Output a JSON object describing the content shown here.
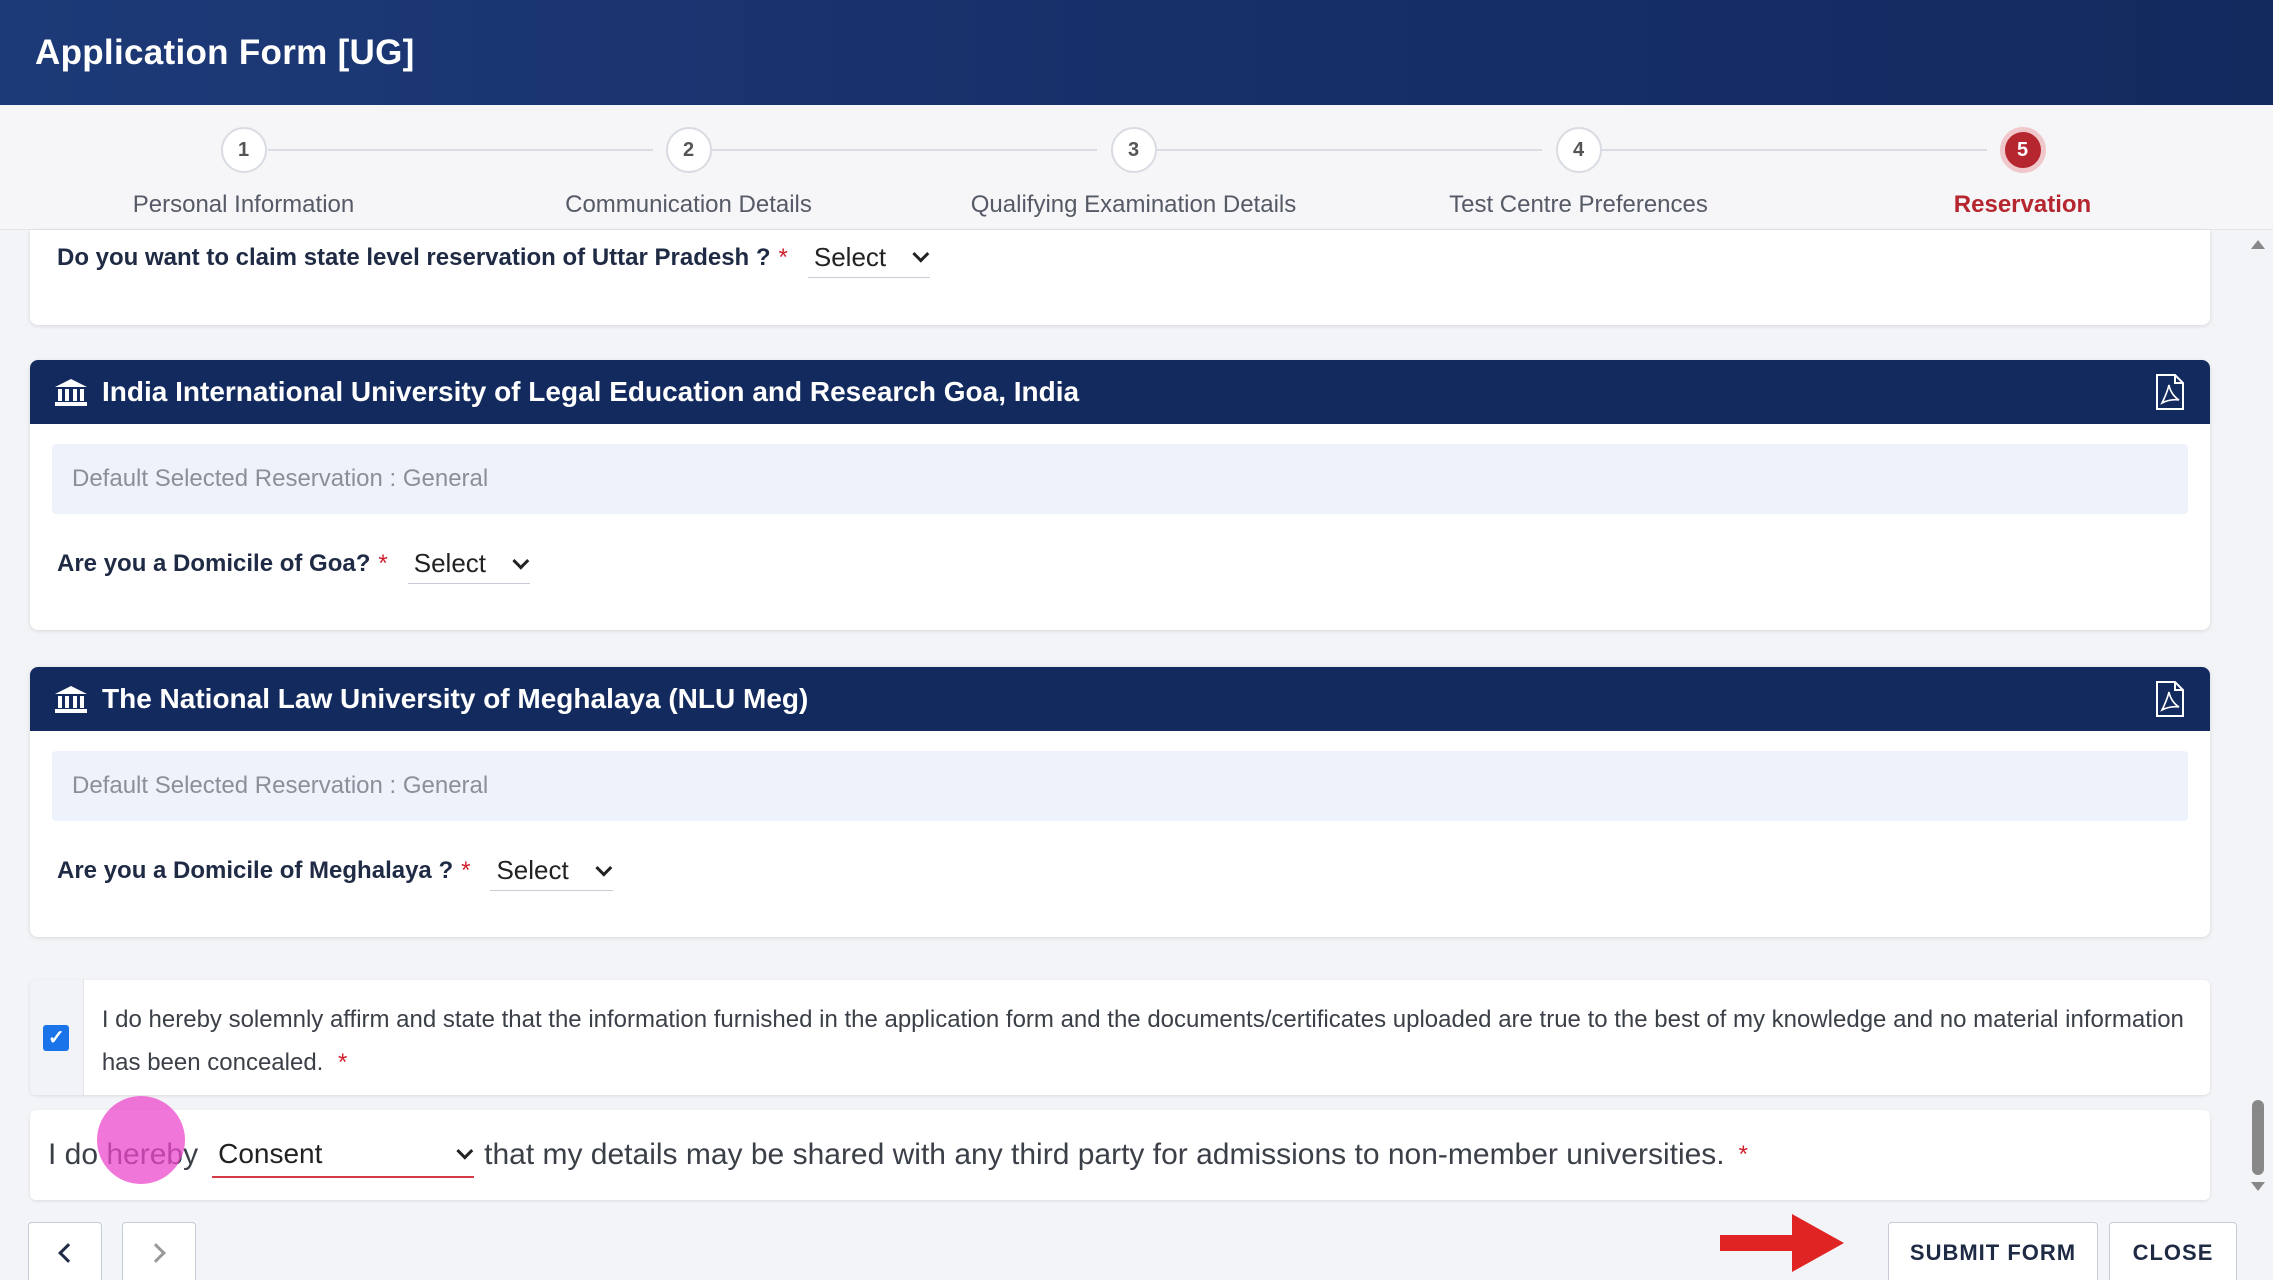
{
  "header": {
    "title": "Application Form [UG]"
  },
  "steps": [
    {
      "number": "1",
      "label": "Personal Information",
      "active": false
    },
    {
      "number": "2",
      "label": "Communication Details",
      "active": false
    },
    {
      "number": "3",
      "label": "Qualifying Examination Details",
      "active": false
    },
    {
      "number": "4",
      "label": "Test Centre Preferences",
      "active": false
    },
    {
      "number": "5",
      "label": "Reservation",
      "active": true
    }
  ],
  "up_reservation": {
    "question": "Do you want to claim state level reservation of Uttar Pradesh ?",
    "required_mark": "*",
    "select_value": "Select"
  },
  "universities": [
    {
      "name": "India International University of Legal Education and Research Goa, India",
      "default_reservation": "Default Selected Reservation : General",
      "question": "Are you a Domicile of Goa?",
      "required_mark": "*",
      "select_value": "Select"
    },
    {
      "name": "The National Law University of Meghalaya (NLU Meg)",
      "default_reservation": "Default Selected Reservation : General",
      "question": "Are you a Domicile of Meghalaya ?",
      "required_mark": "*",
      "select_value": "Select"
    }
  ],
  "declaration": {
    "checked": true,
    "text": "I do hereby solemnly affirm and state that the information furnished in the application form and the documents/certificates uploaded are true to the best of my knowledge and no material information has been concealed.",
    "required_mark": "*"
  },
  "consent": {
    "prefix": "I do hereby",
    "select_value": "Consent",
    "suffix": "that my details may be shared with any third party for admissions to non-member universities.",
    "required_mark": "*"
  },
  "footer": {
    "submit_label": "SUBMIT FORM",
    "close_label": "CLOSE"
  },
  "colors": {
    "header_bg": "#132a5f",
    "active_step": "#b5262e",
    "required": "#d01f2c",
    "checkbox": "#1a73e8",
    "arrow": "#e02424"
  }
}
